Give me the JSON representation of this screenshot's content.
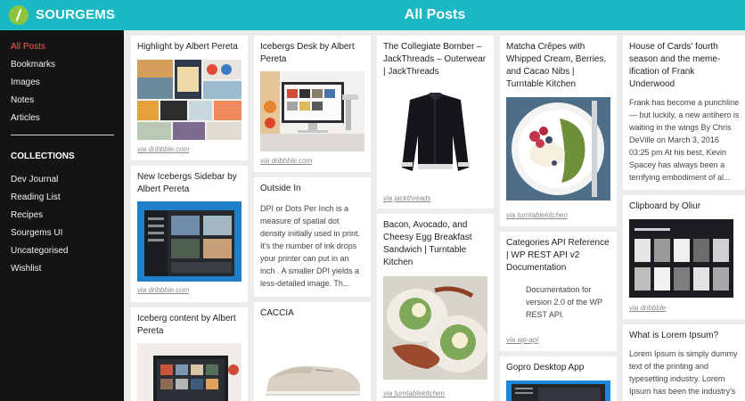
{
  "app": {
    "brand": "SOURGEMS",
    "page_title": "All Posts"
  },
  "sidebar": {
    "nav": [
      "All Posts",
      "Bookmarks",
      "Images",
      "Notes",
      "Articles"
    ],
    "collections_title": "COLLECTIONS",
    "collections": [
      "Dev Journal",
      "Reading List",
      "Recipes",
      "Sourgems UI",
      "Uncategorised",
      "Wishlist"
    ]
  },
  "cards": [
    {
      "title": "Highlight by Albert Pereta",
      "via": "via dribbble.com"
    },
    {
      "title": "New Icebergs Sidebar by Albert Pereta",
      "via": "via dribbble.com"
    },
    {
      "title": "Iceberg content by Albert Pereta"
    },
    {
      "title": "Icebergs Desk by Albert Pereta",
      "via": "via dribbble.com"
    },
    {
      "title": "Outside In",
      "text": "DPI or Dots Per Inch is a measure of spatial dot density initially used in print. It's the number of ink drops your printer can put in an inch . A smaller DPI yields a less-detailed image. Th..."
    },
    {
      "title": "CACCIA"
    },
    {
      "title": "The Collegiate Bomber – JackThreads – Outerwear | JackThreads",
      "via": "via jackthreads"
    },
    {
      "title": "Bacon, Avocado, and Cheesy Egg Breakfast Sandwich | Turntable Kitchen",
      "via": "via turntablekitchen"
    },
    {
      "title": "Matcha Crêpes with Whipped Cream, Berries, and Cacao Nibs | Turntable Kitchen",
      "via": "via turntablekitchen"
    },
    {
      "title": "Categories API Reference | WP REST API v2 Documentation",
      "text": "Documentation for version 2.0 of the WP REST API.",
      "via": "via wp-api"
    },
    {
      "title": "Gopro Desktop App"
    },
    {
      "title": "House of Cards' fourth season and the meme-ification of Frank Underwood",
      "text": "Frank has become a punchline — but luckily, a new antihero is waiting in the wings By Chris DeVille on March 3, 2016 03:25 pm At his best, Kevin Spacey has always been a terrifying embodiment of al..."
    },
    {
      "title": "Clipboard by Oliur",
      "via": "via dribbble"
    },
    {
      "title": "What is Lorem Ipsum?",
      "text": "Lorem Ipsum is simply dummy text of the printing and typesetting industry. Lorem Ipsum has been the industry's"
    }
  ]
}
